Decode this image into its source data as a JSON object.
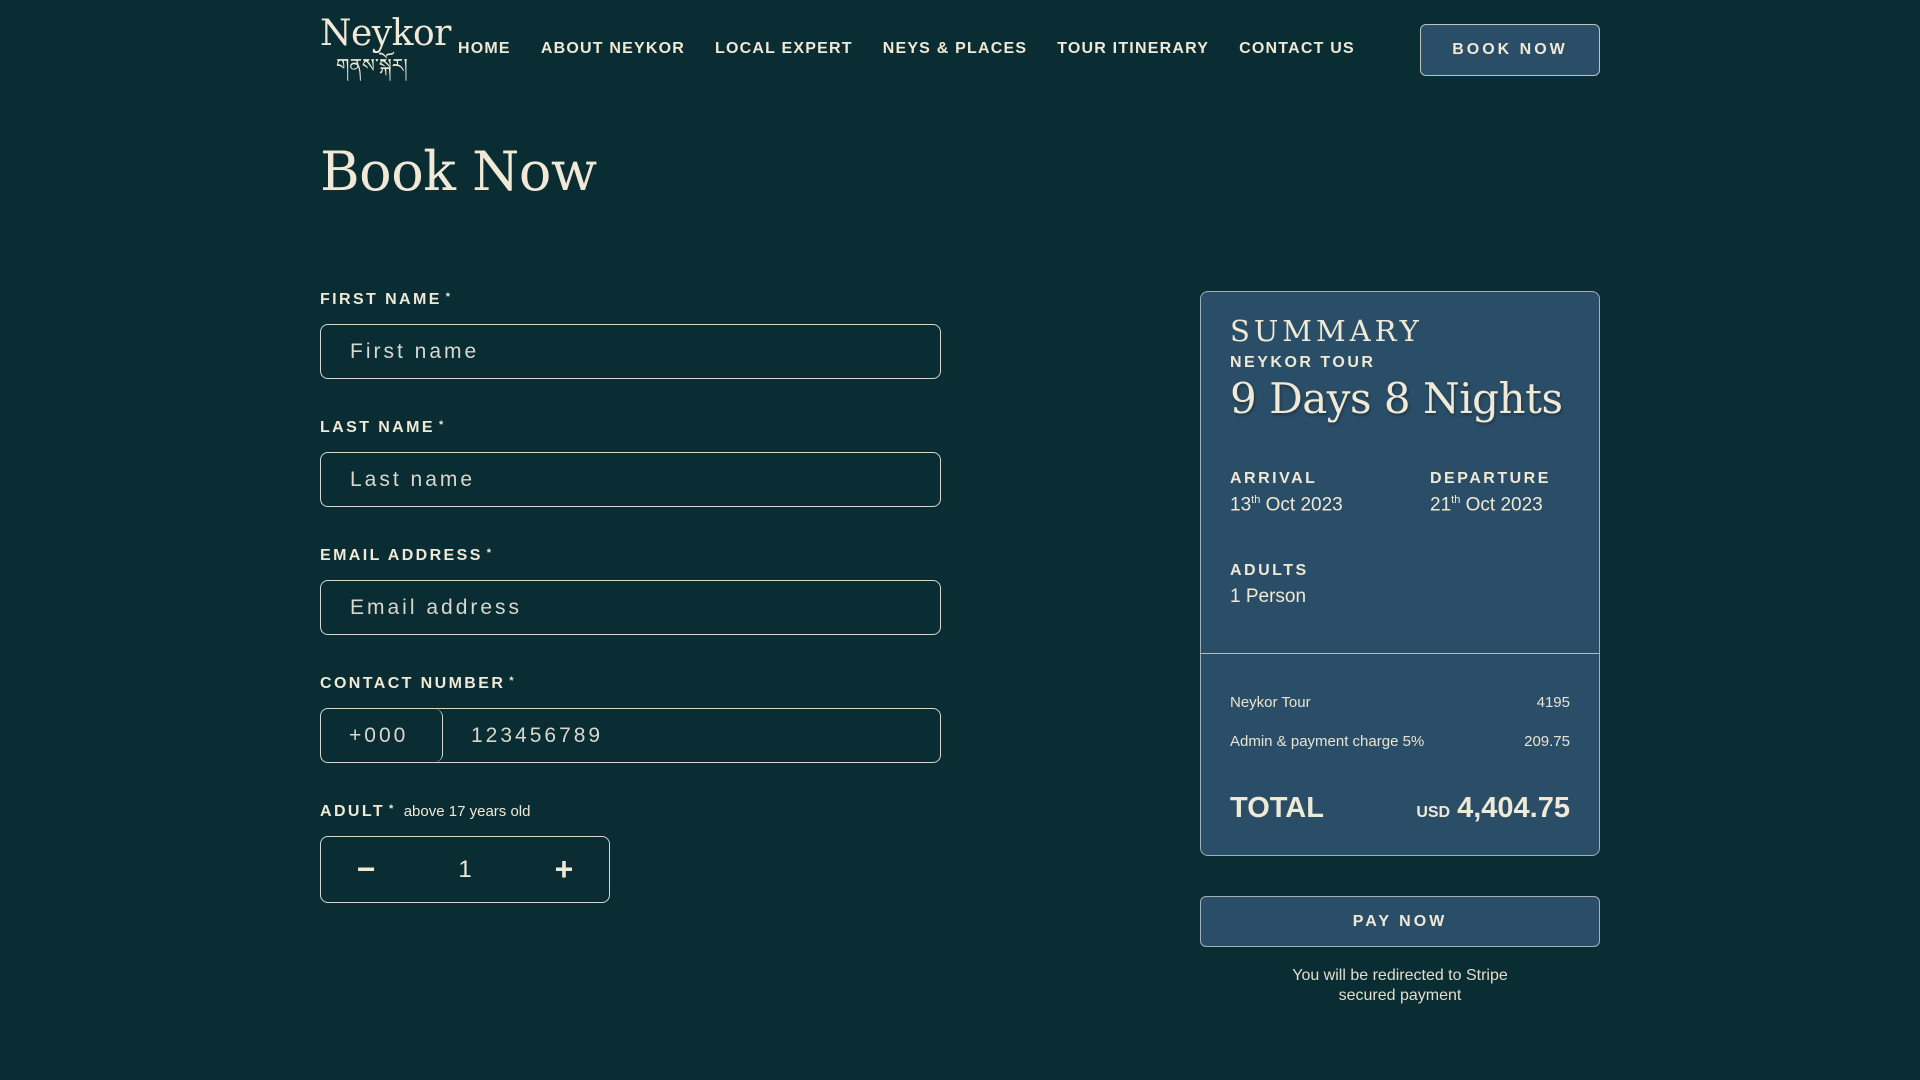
{
  "header": {
    "logo_text": "Neykor",
    "logo_subtext": "གནས་སྐོར།",
    "nav": [
      "HOME",
      "ABOUT NEYKOR",
      "LOCAL EXPERT",
      "NEYS & PLACES",
      "TOUR ITINERARY",
      "CONTACT US"
    ],
    "book_button": "BOOK NOW"
  },
  "page": {
    "title": "Book Now"
  },
  "form": {
    "first_name": {
      "label": "FIRST NAME",
      "required": "*",
      "placeholder": "First name"
    },
    "last_name": {
      "label": "LAST NAME",
      "required": "*",
      "placeholder": "Last name"
    },
    "email": {
      "label": "EMAIL ADDRESS",
      "required": "*",
      "placeholder": "Email address"
    },
    "contact": {
      "label": "CONTACT NUMBER",
      "required": "*",
      "code_placeholder": "+000",
      "number_placeholder": "123456789"
    },
    "adult": {
      "label": "ADULT",
      "required": "*",
      "hint": "above 17 years old",
      "value": "1",
      "minus": "−",
      "plus": "+"
    }
  },
  "summary": {
    "title": "SUMMARY",
    "subtitle": "NEYKOR TOUR",
    "duration": "9 Days 8 Nights",
    "arrival": {
      "label": "ARRIVAL",
      "day": "13",
      "suffix": "th",
      "rest": " Oct 2023"
    },
    "departure": {
      "label": "DEPARTURE",
      "day": "21",
      "suffix": "th",
      "rest": " Oct 2023"
    },
    "adults": {
      "label": "ADULTS",
      "value": "1 Person"
    },
    "items": [
      {
        "name": "Neykor Tour",
        "amount": "4195"
      },
      {
        "name": "Admin & payment charge 5%",
        "amount": "209.75"
      }
    ],
    "total_label": "TOTAL",
    "currency": "USD",
    "total_value": "4,404.75"
  },
  "payment": {
    "pay_button": "PAY NOW",
    "note_line1": "You will be redirected to Stripe",
    "note_line2": "secured payment"
  },
  "colors": {
    "background": "#0a2c33",
    "panel": "#2b4e68",
    "text": "#efe9d6"
  }
}
